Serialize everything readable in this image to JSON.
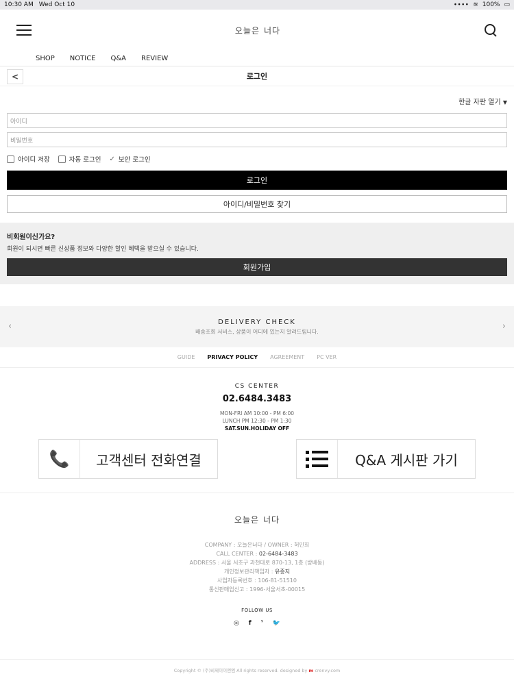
{
  "status_bar": {
    "time": "10:30 AM",
    "date": "Wed Oct 10",
    "battery": "100%"
  },
  "header": {
    "logo_left": "오늘은",
    "logo_right": "너다"
  },
  "nav": {
    "items": [
      "SHOP",
      "NOTICE",
      "Q&A",
      "REVIEW"
    ]
  },
  "page": {
    "title": "로그인",
    "back": "<"
  },
  "keyboard": {
    "label": "한글 자판 열기"
  },
  "form": {
    "id_placeholder": "아이디",
    "pw_placeholder": "비밀번호",
    "save_id": "아이디 저장",
    "auto_login": "자동 로그인",
    "secure_login": "보안 로그인",
    "login_button": "로그인",
    "find_button": "아이디/비밀번호 찾기"
  },
  "join": {
    "title": "비회원이신가요?",
    "desc": "회원이 되시면 빠른 신상품 정보와 다양한 할인 혜택을 받으실 수 있습니다.",
    "button": "회원가입"
  },
  "delivery": {
    "title": "DELIVERY CHECK",
    "subtitle": "배송조회 서비스, 상품이 어디에 있는지 알려드립니다."
  },
  "links": [
    "GUIDE",
    "PRIVACY POLICY",
    "AGREEMENT",
    "PC VER"
  ],
  "cs": {
    "title": "CS CENTER",
    "phone": "02.6484.3483",
    "hours1": "MON-FRI AM 10:00 - PM 6:00",
    "hours2": "LUNCH PM 12:30 - PM 1:30",
    "hours3": "SAT.SUN.HOLIDAY OFF"
  },
  "quick": {
    "call_label": "고객센터 전화연결",
    "qna_label": "Q&A 게시판 가기"
  },
  "footer": {
    "logo_left": "오늘은",
    "logo_right": "너다",
    "company_label": "COMPANY : ",
    "company": "오늘은너다 / OWNER : 허민희",
    "call_label": "CALL CENTER : ",
    "call": "02-6484-3483",
    "address_label": "ADDRESS : ",
    "address": "서울 서초구 과천대로 870-13, 1층 (방배동)",
    "privacy_label": "개인정보관리책임자 : ",
    "privacy": "유종지",
    "biz_label": "사업자등록번호 : ",
    "biz": "106-81-51510",
    "mail_label": "통신판매업신고 : ",
    "mail": "1996-서울서초-00015",
    "follow": "FOLLOW US",
    "sns": [
      "◎",
      "f",
      "❜",
      "🐦"
    ],
    "copyright": "Copyright © (주)비제이이엔엠 All rights reserved. designed by",
    "designer_mark": "m",
    "designer": " crenvy.com"
  }
}
